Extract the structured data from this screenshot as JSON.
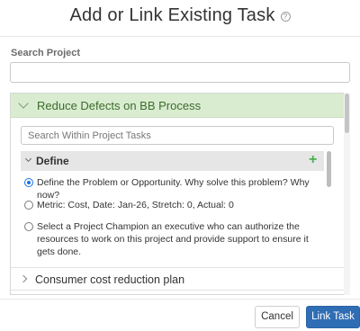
{
  "dialog": {
    "title": "Add or Link Existing Task",
    "help_glyph": "?"
  },
  "search": {
    "label": "Search Project",
    "value": "",
    "placeholder": ""
  },
  "project": {
    "title": "Reduce Defects on BB Process",
    "task_search_placeholder": "Search Within Project Tasks",
    "group": {
      "title": "Define",
      "add_glyph": "+",
      "tasks": [
        {
          "label": "Define the Problem or Opportunity. Why solve this problem? Why now?",
          "selected": true
        },
        {
          "label": "Metric: Cost, Date: Jan-26, Stretch: 0, Actual: 0",
          "selected": false
        },
        {
          "label": "Select a Project Champion an executive who can authorize the resources to work on this project and provide support to ensure it gets done.",
          "selected": false
        }
      ]
    }
  },
  "other_projects": [
    {
      "title": "Consumer cost reduction plan"
    }
  ],
  "footer": {
    "cancel_label": "Cancel",
    "link_label": "Link Task"
  },
  "colors": {
    "project_header_bg": "#d9ecd0",
    "project_title": "#3e6b2e",
    "primary_button": "#2f6db5",
    "add_icon": "#4cae4c",
    "radio_selected": "#1a73e8"
  }
}
